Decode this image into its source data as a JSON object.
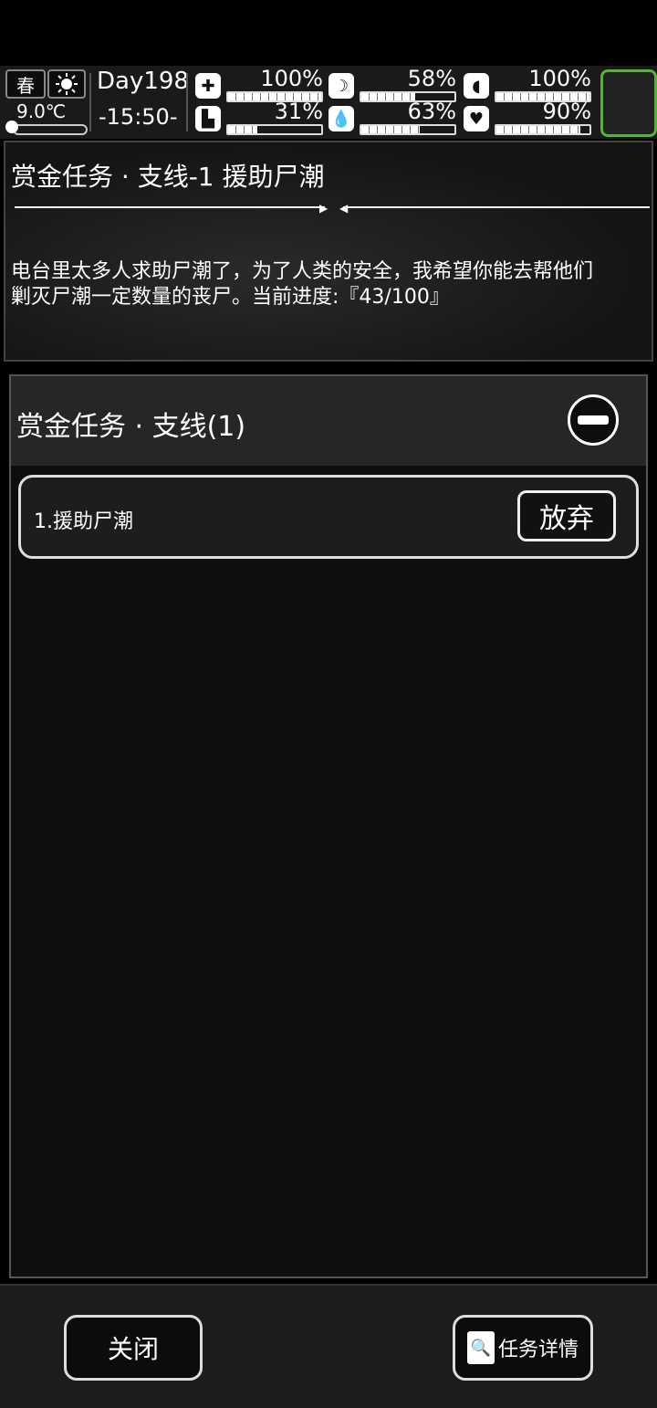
{
  "hud": {
    "season": "春",
    "weather_icon": "sun-icon",
    "temperature": "9.0℃",
    "day": "Day198",
    "time": "-15:50-",
    "stats": [
      {
        "icon": "medkit-icon",
        "glyph": "✚",
        "value": "100%",
        "level": 100
      },
      {
        "icon": "stomach-icon",
        "glyph": "☽",
        "value": "58%",
        "level": 58
      },
      {
        "icon": "pill-icon",
        "glyph": "◖",
        "value": "100%",
        "level": 100
      },
      {
        "icon": "boot-icon",
        "glyph": "▙",
        "value": "31%",
        "level": 31
      },
      {
        "icon": "water-drop-icon",
        "glyph": "💧",
        "value": "63%",
        "level": 63
      },
      {
        "icon": "heart-icon",
        "glyph": "♥",
        "value": "90%",
        "level": 90
      }
    ]
  },
  "quest": {
    "title": "赏金任务 · 支线-1 援助尸潮",
    "description_line1": "电台里太多人求助尸潮了，为了人类的安全，我希望你能去帮他们",
    "description_line2": "剿灭尸潮一定数量的丧尸。当前进度:『43/100』"
  },
  "list": {
    "header": "赏金任务 · 支线(1)",
    "items": [
      {
        "label": "1.援助尸潮",
        "action": "放弃"
      }
    ]
  },
  "footer": {
    "close_label": "关闭",
    "detail_label": "任务详情"
  },
  "colors": {
    "slot_border": "#54b43a",
    "background": "#000000"
  }
}
